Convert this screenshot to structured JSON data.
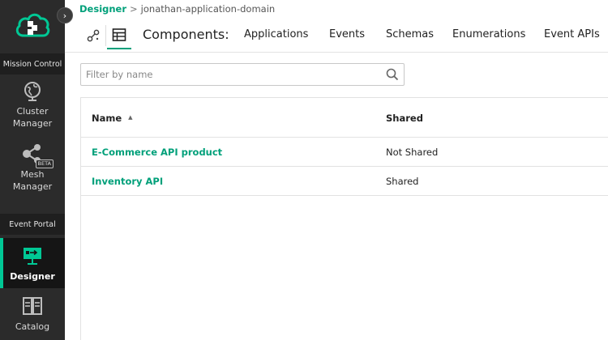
{
  "sidebar": {
    "sections": [
      {
        "label": "Mission Control"
      },
      {
        "label": "Event Portal"
      }
    ],
    "items": [
      {
        "label": "Cluster Manager",
        "icon": "globe-icon"
      },
      {
        "label": "Mesh Manager",
        "icon": "mesh-icon",
        "badge": "BETA"
      },
      {
        "label": "Designer",
        "icon": "designer-icon",
        "active": true
      },
      {
        "label": "Catalog",
        "icon": "catalog-icon"
      }
    ],
    "collapse_glyph": "›"
  },
  "breadcrumb": {
    "root": "Designer",
    "separator": ">",
    "current": "jonathan-application-domain"
  },
  "toolbar": {
    "components_label": "Components:",
    "tabs": [
      {
        "label": "Applications"
      },
      {
        "label": "Events"
      },
      {
        "label": "Schemas"
      },
      {
        "label": "Enumerations"
      },
      {
        "label": "Event APIs"
      }
    ]
  },
  "search": {
    "placeholder": "Filter by name",
    "value": ""
  },
  "table": {
    "columns": [
      {
        "label": "Name",
        "sort": "ascending",
        "sort_glyph": "▲"
      },
      {
        "label": "Shared"
      }
    ],
    "rows": [
      {
        "name": "E-Commerce API product",
        "shared": "Not Shared"
      },
      {
        "name": "Inventory API",
        "shared": "Shared"
      }
    ]
  },
  "colors": {
    "accent": "#00a07a",
    "sidebar_bg": "#2b2b2b",
    "active_bar": "#00c895"
  }
}
